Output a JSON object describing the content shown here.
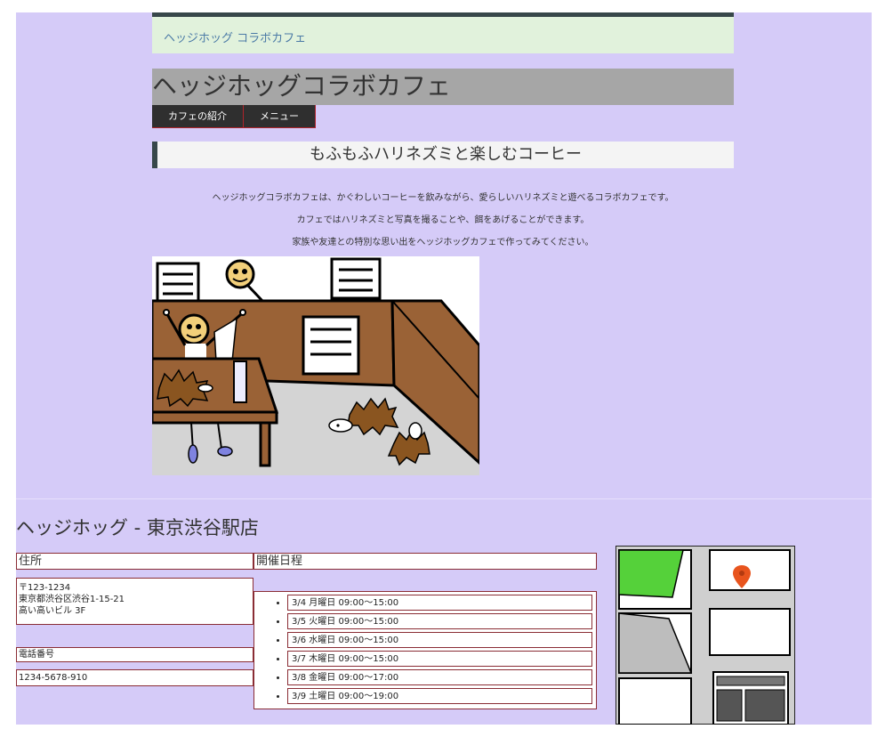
{
  "header": {
    "site_link": "ヘッジホッグ コラボカフェ",
    "title": "ヘッジホッグコラボカフェ",
    "nav": [
      "カフェの紹介",
      "メニュー"
    ]
  },
  "intro_section": {
    "heading": "もふもふハリネズミと楽しむコーヒー",
    "paragraphs": [
      "ヘッジホッグコラボカフェは、かぐわしいコーヒーを飲みながら、愛らしいハリネズミと遊べるコラボカフェです。",
      "カフェではハリネズミと写真を撮ることや、餌をあげることができます。",
      "家族や友達との特別な思い出をヘッジホッグカフェで作ってみてください。"
    ]
  },
  "store": {
    "title": "ヘッジホッグ - 東京渋谷駅店",
    "address_label": "住所",
    "address_lines": [
      "〒123-1234",
      "東京都渋谷区渋谷1-15-21",
      "高い高いビル 3F"
    ],
    "phone_label": "電話番号",
    "phone": "1234-5678-910",
    "schedule_label": "開催日程",
    "schedule": [
      "3/4 月曜日 09:00〜15:00",
      "3/5 火曜日 09:00〜15:00",
      "3/6 水曜日 09:00〜15:00",
      "3/7 木曜日 09:00〜15:00",
      "3/8 金曜日 09:00〜17:00",
      "3/9 土曜日 09:00〜19:00"
    ]
  },
  "colors": {
    "page_bg": "#d5cbf8",
    "site_bar_bg": "#e1f2dc",
    "title_bg": "#a6a6a6",
    "nav_bg": "#2f2f2f",
    "accent_border": "#8a2d35",
    "map_pin": "#e8541d"
  },
  "icons": {
    "map_pin": "map-pin-icon"
  }
}
